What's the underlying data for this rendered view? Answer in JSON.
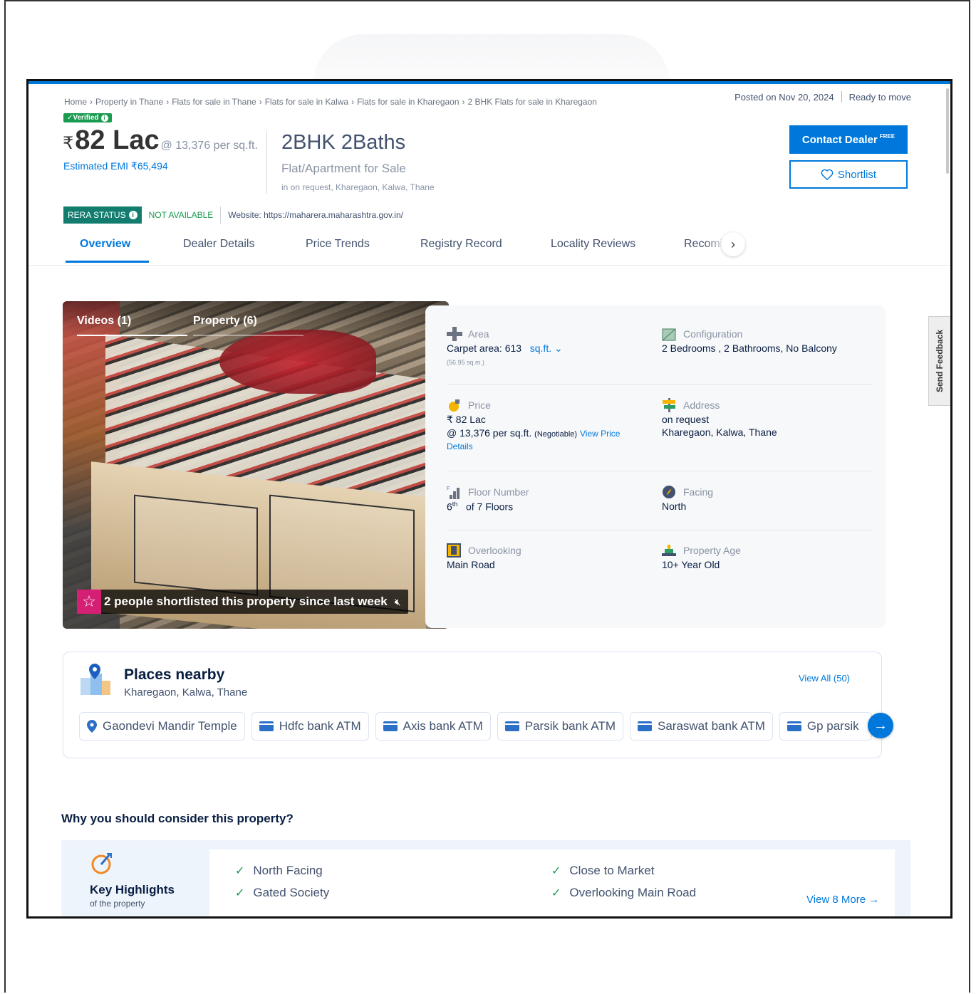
{
  "breadcrumb": [
    "Home",
    "Property in Thane",
    "Flats for sale in Thane",
    "Flats for sale in Kalwa",
    "Flats for sale in Kharegaon",
    "2 BHK Flats for sale in Kharegaon"
  ],
  "breadcrumb_sep": "›",
  "posted": {
    "date": "Posted on Nov 20, 2024",
    "status": "Ready to move"
  },
  "verified_label": "✓Verified",
  "price": {
    "rupee": "₹",
    "amount": "82 Lac",
    "per_sqft": "@ 13,376 per sq.ft.",
    "emi": "Estimated EMI ₹65,494"
  },
  "config": {
    "title": "2BHK 2Baths",
    "type": "Flat/Apartment for Sale",
    "location": "in on request, Kharegaon, Kalwa, Thane"
  },
  "buttons": {
    "contact": "Contact Dealer",
    "contact_badge": "FREE",
    "shortlist": "Shortlist"
  },
  "rera": {
    "badge": "RERA STATUS",
    "status": "NOT AVAILABLE",
    "website": "Website: https://maharera.maharashtra.gov.in/"
  },
  "tabs": [
    "Overview",
    "Dealer Details",
    "Price Trends",
    "Registry Record",
    "Locality Reviews",
    "Recomi"
  ],
  "media": {
    "videos": "Videos (1)",
    "property": "Property (6)",
    "shortlisted": "2 people shortlisted this property since last week"
  },
  "details": {
    "area": {
      "label": "Area",
      "value": "Carpet area: 613",
      "unit": "sq.ft.",
      "sub": "(56.95 sq.m.)"
    },
    "configuration": {
      "label": "Configuration",
      "value": "2 Bedrooms , 2 Bathrooms, No Balcony"
    },
    "price": {
      "label": "Price",
      "value": "₹ 82 Lac",
      "per_sqft": "@ 13,376 per sq.ft.",
      "negotiable": "(Negotiable)",
      "link1": "View Price",
      "link2": "Details"
    },
    "address": {
      "label": "Address",
      "line1": "on request",
      "line2": "Kharegaon, Kalwa, Thane"
    },
    "floor": {
      "label": "Floor Number",
      "floor": "6",
      "sup": "th",
      "rest": "of 7 Floors"
    },
    "facing": {
      "label": "Facing",
      "value": "North"
    },
    "overlooking": {
      "label": "Overlooking",
      "value": "Main Road"
    },
    "age": {
      "label": "Property Age",
      "value": "10+ Year Old"
    }
  },
  "nearby": {
    "title": "Places nearby",
    "subtitle": "Kharegaon, Kalwa, Thane",
    "view_all": "View All (50)",
    "places": [
      {
        "icon": "pin-icon",
        "name": "Gaondevi Mandir Temple"
      },
      {
        "icon": "atm-icon",
        "name": "Hdfc bank ATM"
      },
      {
        "icon": "atm-icon",
        "name": "Axis bank ATM"
      },
      {
        "icon": "atm-icon",
        "name": "Parsik bank ATM"
      },
      {
        "icon": "atm-icon",
        "name": "Saraswat bank ATM"
      },
      {
        "icon": "atm-icon",
        "name": "Gp parsik"
      }
    ]
  },
  "why": {
    "title": "Why you should consider this property?",
    "key_title": "Key Highlights",
    "key_sub": "of the property",
    "items": [
      "North Facing",
      "Gated Society",
      "Close to Market",
      "Overlooking Main Road"
    ],
    "view_more": "View 8 More →"
  },
  "feedback": "Send Feedback",
  "colors": {
    "accent": "#0078db",
    "rera": "#127d6f",
    "verified": "#1a9b50",
    "star": "#d41f74"
  }
}
